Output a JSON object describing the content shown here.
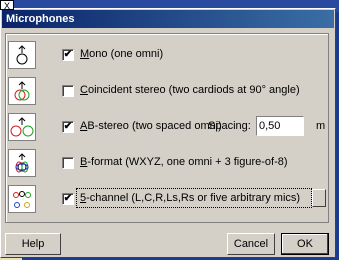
{
  "window": {
    "title": "Microphones",
    "close_glyph": "X"
  },
  "rows": [
    {
      "icon": "mono-omni-mic-icon",
      "checked": true,
      "label_pre": "",
      "label_u": "M",
      "label_post": "ono (one omni)"
    },
    {
      "icon": "coincident-stereo-mic-icon",
      "checked": false,
      "label_pre": "",
      "label_u": "C",
      "label_post": "oincident stereo (two cardiods at 90° angle)"
    },
    {
      "icon": "ab-stereo-mic-icon",
      "checked": true,
      "label_pre": "",
      "label_u": "A",
      "label_post": "B-stereo (two spaced omni)"
    },
    {
      "icon": "b-format-mic-icon",
      "checked": false,
      "label_pre": "",
      "label_u": "B",
      "label_post": "-format (WXYZ, one omni + 3 figure-of-8)"
    },
    {
      "icon": "five-channel-mic-icon",
      "checked": true,
      "label_pre": "",
      "label_u": "5",
      "label_post": "-channel (L,C,R,Ls,Rs or five arbitrary mics)"
    }
  ],
  "spacing": {
    "label": "Spacing:",
    "value": "0,50",
    "unit": "m"
  },
  "buttons": {
    "help": "Help",
    "cancel": "Cancel",
    "ok": "OK"
  },
  "checkmark": "✔"
}
